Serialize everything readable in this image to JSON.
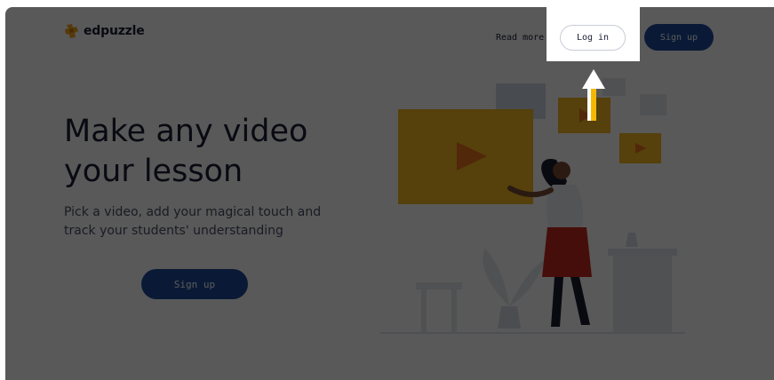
{
  "nav": {
    "logo_text": "edpuzzle",
    "read_more_label": "Read more",
    "login_label": "Log in",
    "signup_label": "Sign up"
  },
  "hero": {
    "title_line1": "Make any video",
    "title_line2": "your lesson",
    "subtitle_line1": "Pick a video, add your magical touch and",
    "subtitle_line2": "track your students' understanding",
    "signup_label": "Sign up"
  },
  "colors": {
    "brand_blue": "#1d4a9c",
    "brand_orange": "#f5a623",
    "overlay": "rgba(0,0,0,0.65)",
    "arrow_accent": "#f5b800"
  },
  "icons": {
    "logo": "edpuzzle-logo-icon",
    "pointer": "up-arrow-icon"
  }
}
